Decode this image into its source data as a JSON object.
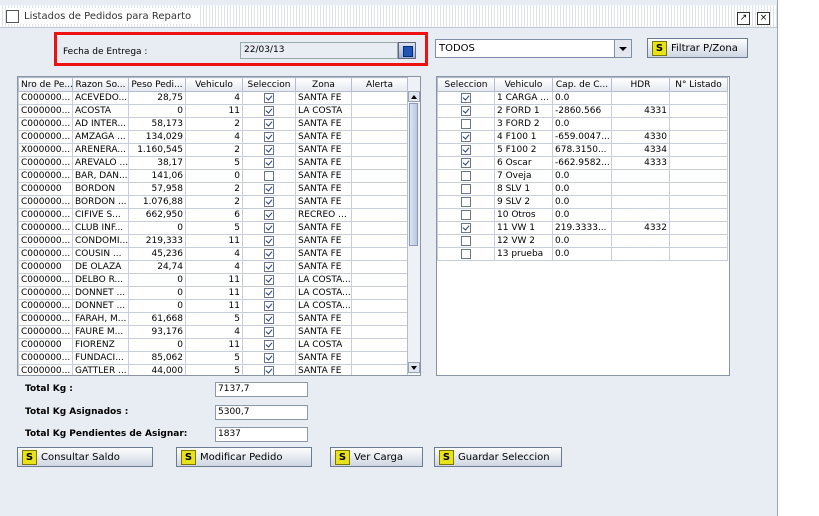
{
  "window": {
    "title": "Listados de Pedidos para Reparto",
    "restore_icon": "restore-icon",
    "close_icon": "close-icon"
  },
  "fecha": {
    "label": "Fecha de Entrega :",
    "value": "22/03/13"
  },
  "zona_combo": {
    "value": "TODOS"
  },
  "buttons": {
    "filtrar": "Filtrar P/Zona",
    "consultar": "Consultar Saldo",
    "modificar": "Modificar Pedido",
    "ver_carga": "Ver Carga",
    "guardar": "Guardar Seleccion",
    "s_glyph": "S"
  },
  "pedidos": {
    "columns": [
      "Nro de Pe...",
      "Razon So...",
      "Peso Pedi...",
      "Vehiculo",
      "Seleccion",
      "Zona",
      "Alerta"
    ],
    "rows": [
      {
        "nro": "C000000...",
        "razon": "ACEVEDO...",
        "peso": "28,75",
        "veh": "4",
        "sel": true,
        "zona": "SANTA FE"
      },
      {
        "nro": "C000000...",
        "razon": "ACOSTA",
        "peso": "0",
        "veh": "11",
        "sel": true,
        "zona": "LA COSTA"
      },
      {
        "nro": "C000000...",
        "razon": "AD INTER...",
        "peso": "58,173",
        "veh": "2",
        "sel": true,
        "zona": "SANTA FE"
      },
      {
        "nro": "C000000...",
        "razon": "AMZAGA ...",
        "peso": "134,029",
        "veh": "4",
        "sel": true,
        "zona": "SANTA FE"
      },
      {
        "nro": "X000000...",
        "razon": "ARENERA...",
        "peso": "1.160,545",
        "veh": "2",
        "sel": true,
        "zona": "SANTA FE"
      },
      {
        "nro": "C000000...",
        "razon": "AREVALO ...",
        "peso": "38,17",
        "veh": "5",
        "sel": true,
        "zona": "SANTA FE"
      },
      {
        "nro": "C000000...",
        "razon": "BAR, DAN...",
        "peso": "141,06",
        "veh": "0",
        "sel": false,
        "zona": "SANTA FE"
      },
      {
        "nro": "C000000",
        "razon": "BORDON",
        "peso": "57,958",
        "veh": "2",
        "sel": true,
        "zona": "SANTA FE"
      },
      {
        "nro": "C000000...",
        "razon": "BORDON ...",
        "peso": "1.076,88",
        "veh": "2",
        "sel": true,
        "zona": "SANTA FE"
      },
      {
        "nro": "C000000...",
        "razon": "CIFIVE S...",
        "peso": "662,950",
        "veh": "6",
        "sel": true,
        "zona": "RECREO ..."
      },
      {
        "nro": "C000000...",
        "razon": "CLUB INF...",
        "peso": "0",
        "veh": "5",
        "sel": true,
        "zona": "SANTA FE"
      },
      {
        "nro": "C000000...",
        "razon": "CONDOMI...",
        "peso": "219,333",
        "veh": "11",
        "sel": true,
        "zona": "SANTA FE"
      },
      {
        "nro": "C000000...",
        "razon": "COUSIN ...",
        "peso": "45,236",
        "veh": "4",
        "sel": true,
        "zona": "SANTA FE"
      },
      {
        "nro": "C000000",
        "razon": "DE OLAZA",
        "peso": "24,74",
        "veh": "4",
        "sel": true,
        "zona": "SANTA FE"
      },
      {
        "nro": "C000000...",
        "razon": "DELBO R...",
        "peso": "0",
        "veh": "11",
        "sel": true,
        "zona": "LA COSTA..."
      },
      {
        "nro": "C000000...",
        "razon": "DONNET ...",
        "peso": "0",
        "veh": "11",
        "sel": true,
        "zona": "LA COSTA..."
      },
      {
        "nro": "C000000...",
        "razon": "DONNET ...",
        "peso": "0",
        "veh": "11",
        "sel": true,
        "zona": "LA COSTA..."
      },
      {
        "nro": "C000000...",
        "razon": "FARAH, M...",
        "peso": "61,668",
        "veh": "5",
        "sel": true,
        "zona": "SANTA FE"
      },
      {
        "nro": "C000000...",
        "razon": "FAURE M...",
        "peso": "93,176",
        "veh": "4",
        "sel": true,
        "zona": "SANTA FE"
      },
      {
        "nro": "C000000",
        "razon": "FIORENZ",
        "peso": "0",
        "veh": "11",
        "sel": true,
        "zona": "LA COSTA"
      },
      {
        "nro": "C000000...",
        "razon": "FUNDACI...",
        "peso": "85,062",
        "veh": "5",
        "sel": true,
        "zona": "SANTA FE"
      },
      {
        "nro": "C000000...",
        "razon": "GATTLER ...",
        "peso": "44,000",
        "veh": "5",
        "sel": true,
        "zona": "SANTA FE"
      }
    ]
  },
  "vehiculos": {
    "columns": [
      "Seleccion",
      "Vehiculo",
      "Cap. de C...",
      "HDR",
      "N° Listado"
    ],
    "rows": [
      {
        "sel": true,
        "veh": "1 CARGA ...",
        "cap": "0.0",
        "hdr": ""
      },
      {
        "sel": true,
        "veh": "2 FORD 1",
        "cap": "-2860.566",
        "hdr": "4331"
      },
      {
        "sel": false,
        "veh": "3 FORD 2",
        "cap": "0.0",
        "hdr": ""
      },
      {
        "sel": true,
        "veh": "4 F100 1",
        "cap": "-659.0047...",
        "hdr": "4330"
      },
      {
        "sel": true,
        "veh": "5 F100 2",
        "cap": "678.3150...",
        "hdr": "4334"
      },
      {
        "sel": true,
        "veh": "6 Oscar",
        "cap": "-662.9582...",
        "hdr": "4333"
      },
      {
        "sel": false,
        "veh": "7 Oveja",
        "cap": "0.0",
        "hdr": ""
      },
      {
        "sel": false,
        "veh": "8 SLV 1",
        "cap": "0.0",
        "hdr": ""
      },
      {
        "sel": false,
        "veh": "9 SLV 2",
        "cap": "0.0",
        "hdr": ""
      },
      {
        "sel": false,
        "veh": "10 Otros",
        "cap": "0.0",
        "hdr": ""
      },
      {
        "sel": true,
        "veh": "11 VW 1",
        "cap": "219.3333...",
        "hdr": "4332"
      },
      {
        "sel": false,
        "veh": "12 VW 2",
        "cap": "0.0",
        "hdr": ""
      },
      {
        "sel": false,
        "veh": "13 prueba",
        "cap": "0.0",
        "hdr": ""
      }
    ]
  },
  "totales": {
    "total_kg_label": "Total Kg :",
    "total_kg": "7137,7",
    "asignados_label": "Total Kg Asignados :",
    "asignados": "5300,7",
    "pendientes_label": "Total Kg Pendientes de Asignar:",
    "pendientes": "1837"
  }
}
